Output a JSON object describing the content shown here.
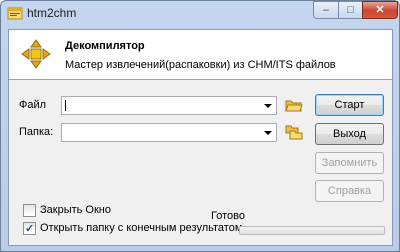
{
  "window": {
    "title": "htm2chm",
    "minimize": "–",
    "maximize": "□",
    "close": "✕"
  },
  "banner": {
    "title": "Декомпилятор",
    "subtitle": "Мастер извлечений(распаковки) из CHM/ITS файлов"
  },
  "form": {
    "file_label": "Файл",
    "file_value": "",
    "folder_label": "Папка:",
    "folder_value": ""
  },
  "buttons": {
    "start": "Старт",
    "exit": "Выход",
    "remember": "Запомнить",
    "help": "Справка"
  },
  "options": {
    "close_window": {
      "label": "Закрыть Окно",
      "checked": false
    },
    "open_folder": {
      "label": "Открыть папку с конечным результатом",
      "checked": true
    }
  },
  "status": {
    "text": "Готово",
    "progress": 0
  },
  "icons": {
    "app": "app-icon",
    "banner": "arrows-move-icon",
    "browse_file": "folder-open-icon",
    "browse_folder": "folder-tree-icon",
    "dropdown": "dropdown-arrow-icon"
  }
}
